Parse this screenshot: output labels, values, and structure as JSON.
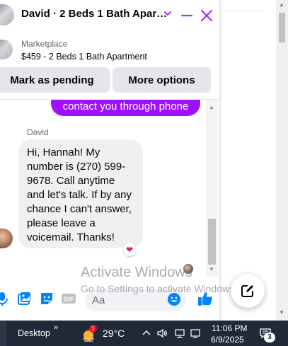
{
  "chat": {
    "title": "David · 2 Beds 1 Bath Apar…",
    "marketplace_label": "Marketplace",
    "listing": "$459 - 2 Beds 1 Bath Apartment",
    "buttons": {
      "pending": "Mark as pending",
      "more": "More options"
    },
    "sent_message_tail": "contact you through phone",
    "sender": "David",
    "received_message": "Hi, Hannah! My number is (270) 599-9678. Call anytime and let's talk. If by any chance I can't answer, please leave a voicemail. Thanks!",
    "reaction": "❤",
    "input_placeholder": "Aa",
    "colors": {
      "accent": "#a033ff",
      "sent_bubble": "#9f10ff",
      "received_bubble": "#f0f0f0",
      "like": "#0084ff"
    }
  },
  "watermark": {
    "title": "Activate Windows",
    "subtitle": "Go to Settings to activate Windows."
  },
  "icons": {
    "chevron": "chevron-down-icon",
    "minimize": "minimize-icon",
    "close": "close-icon",
    "mic": "microphone-icon",
    "photo": "photo-icon",
    "sticker": "sticker-icon",
    "gif": "gif-icon",
    "emoji": "emoji-icon",
    "like": "thumbs-up-icon",
    "compose": "compose-icon"
  },
  "taskbar": {
    "desktop": "Desktop",
    "chevron": "»",
    "weather_badge": "1",
    "temperature": "29°C",
    "time": "11:06 PM",
    "date": "6/9/2025",
    "notification_count": "3"
  }
}
